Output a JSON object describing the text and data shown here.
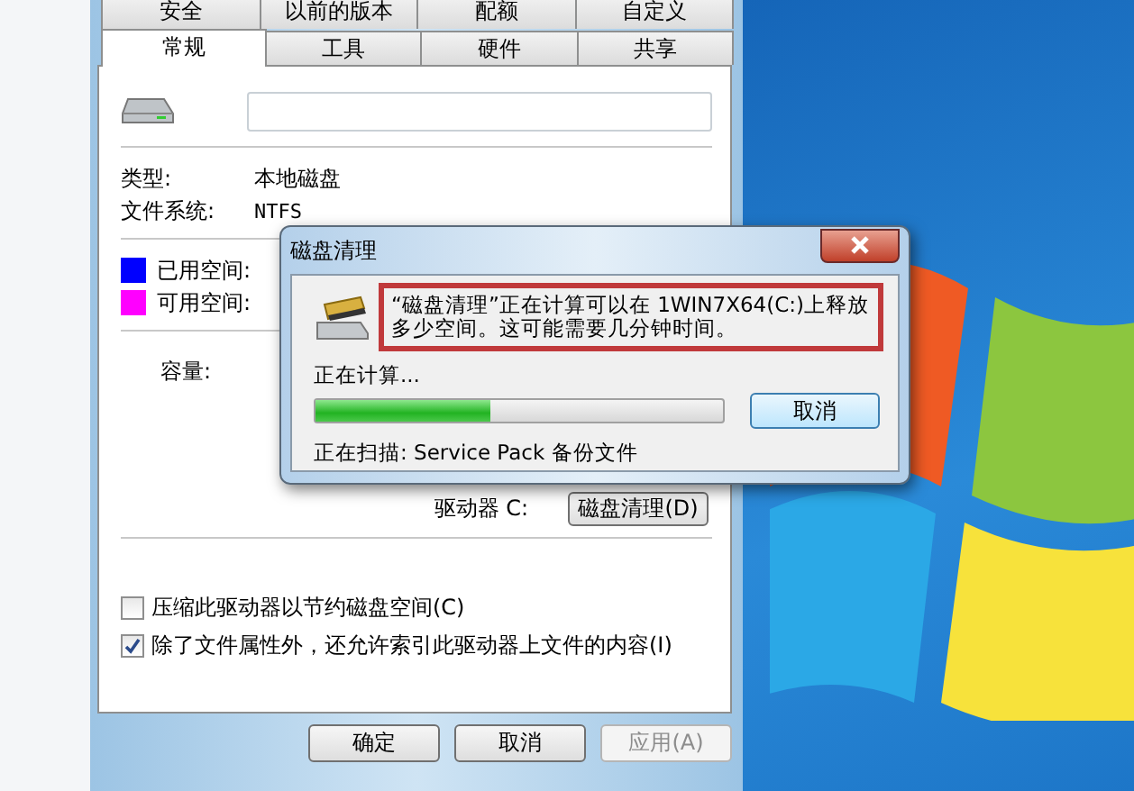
{
  "properties": {
    "tabs_back": [
      {
        "label": "安全"
      },
      {
        "label": "以前的版本"
      },
      {
        "label": "配额"
      },
      {
        "label": "自定义"
      }
    ],
    "tabs_front": [
      {
        "label": "常规",
        "selected": true
      },
      {
        "label": "工具",
        "selected": false
      },
      {
        "label": "硬件",
        "selected": false
      },
      {
        "label": "共享",
        "selected": false
      }
    ],
    "fields": [
      {
        "label": "类型:",
        "value": "本地磁盘"
      },
      {
        "label": "文件系统:",
        "value": "NTFS"
      }
    ],
    "legend": [
      {
        "label": "已用空间:",
        "color": "#0000ff"
      },
      {
        "label": "可用空间:",
        "color": "#ff00ff"
      }
    ],
    "capacity_label": "容量:",
    "drive_label": "驱动器 C:",
    "cleanup_button": "磁盘清理(D)",
    "checkboxes": [
      {
        "label": "压缩此驱动器以节约磁盘空间(C)",
        "checked": false
      },
      {
        "label": "除了文件属性外，还允许索引此驱动器上文件的内容(I)",
        "checked": true
      }
    ],
    "buttons": [
      {
        "label": "确定",
        "disabled": false
      },
      {
        "label": "取消",
        "disabled": false
      },
      {
        "label": "应用(A)",
        "disabled": true
      }
    ]
  },
  "cleanup_dialog": {
    "title": "磁盘清理",
    "message": "“磁盘清理”正在计算可以在 1WIN7X64(C:)上释放多少空间。这可能需要几分钟时间。",
    "highlighted": true,
    "status": "正在计算...",
    "level": 0.43,
    "cancel": "取消",
    "scanning": "正在扫描: Service Pack 备份文件"
  }
}
